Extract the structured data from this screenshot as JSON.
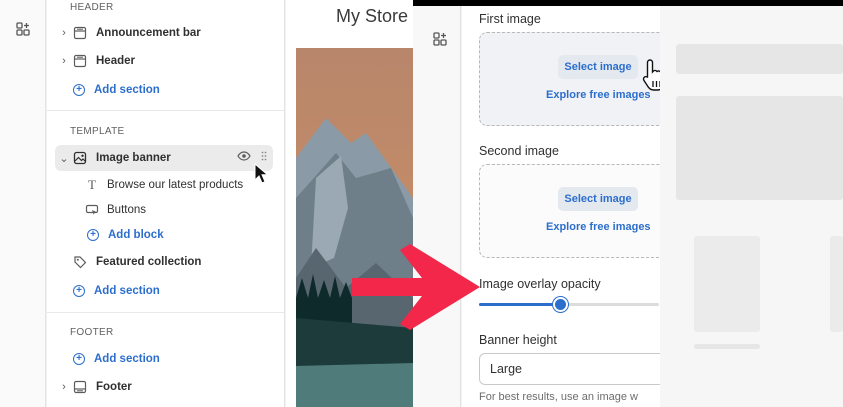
{
  "left_editor": {
    "header_group": {
      "title": "HEADER",
      "items": [
        "Announcement bar",
        "Header"
      ],
      "add_label": "Add section"
    },
    "template_group": {
      "title": "TEMPLATE",
      "selected_section": "Image banner",
      "blocks": [
        "Browse our latest products",
        "Buttons"
      ],
      "add_block_label": "Add block",
      "other_sections": [
        "Featured collection"
      ],
      "add_label": "Add section"
    },
    "footer_group": {
      "title": "FOOTER",
      "add_label": "Add section",
      "items": [
        "Footer"
      ]
    },
    "preview": {
      "store_title": "My Store"
    }
  },
  "right_settings": {
    "first_image": {
      "label": "First image",
      "select_label": "Select image",
      "explore_label": "Explore free images"
    },
    "second_image": {
      "label": "Second image",
      "select_label": "Select image",
      "explore_label": "Explore free images"
    },
    "overlay_opacity": {
      "label": "Image overlay opacity",
      "value_fraction": 0.45
    },
    "banner_height": {
      "label": "Banner height",
      "value": "Large"
    },
    "help_text": "For best results, use an image w"
  },
  "colors": {
    "accent": "#2c6ecb",
    "arrow": "#f2274a",
    "selected_row": "#ebebeb"
  }
}
